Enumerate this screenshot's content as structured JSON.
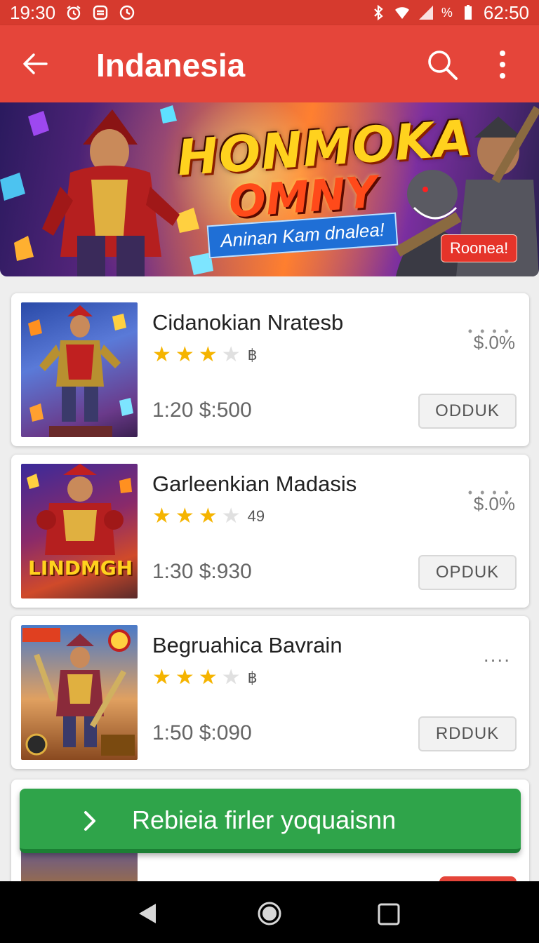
{
  "status_bar": {
    "time": "19:30",
    "battery_pct": "%",
    "battery_time": "62:50",
    "icons": [
      "alarm-icon",
      "message-icon",
      "sync-icon",
      "bluetooth-icon",
      "wifi-icon",
      "signal-icon",
      "battery-icon"
    ]
  },
  "app_bar": {
    "title": "Indanesia",
    "back_icon": "arrow-left-icon",
    "search_icon": "search-icon",
    "menu_icon": "more-vertical-icon"
  },
  "banner": {
    "title_line1": "HONMOKA",
    "title_line2": "OMNY",
    "tagline": "Aninan Kam dnalea!",
    "badge": "Roonea!"
  },
  "items": [
    {
      "name": "Cidanokian Nratesb",
      "rating": 3,
      "max_rating": 5,
      "rating_label": "฿",
      "meta": "1:20  $:500",
      "price_note": "$.0%",
      "button": "ODDUK"
    },
    {
      "name": "Garleenkian Madasis",
      "rating": 3,
      "max_rating": 5,
      "rating_label": "49",
      "meta": "1:30  $:930",
      "price_note": "$.0%",
      "thumb_text": "LINDMGH",
      "button": "OPDUK"
    },
    {
      "name": "Begruahica Bavrain",
      "rating": 3,
      "max_rating": 5,
      "rating_label": "฿",
      "meta": "1:50  $:090",
      "price_note": "....",
      "button": "RDDUK"
    }
  ],
  "cta": {
    "label": "Rebieia firler yoquaisnn",
    "icon": "chevron-right-icon"
  },
  "nav_bar": {
    "back": "nav-back-icon",
    "home": "nav-home-icon",
    "recents": "nav-recents-icon"
  },
  "colors": {
    "app_bar": "#e5453a",
    "status_bar": "#d63a2e",
    "cta": "#2fa44a",
    "star": "#f5b400"
  }
}
